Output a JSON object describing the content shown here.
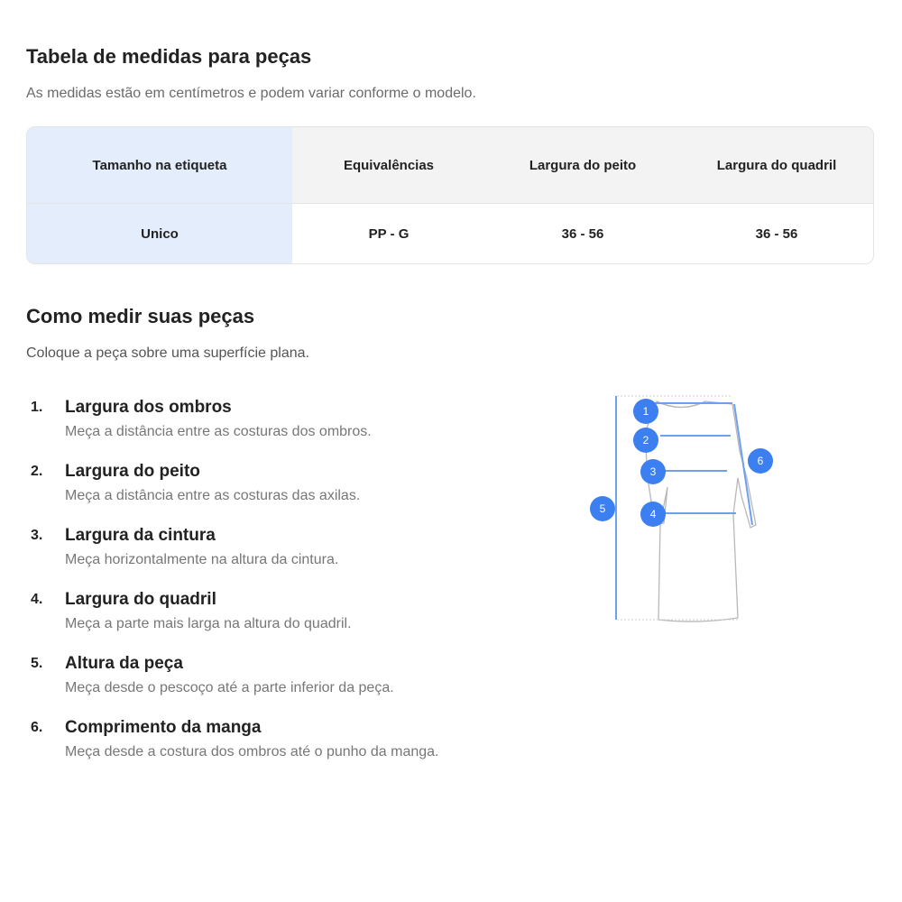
{
  "header": {
    "title": "Tabela de medidas para peças",
    "subtitle": "As medidas estão em centímetros e podem variar conforme o modelo."
  },
  "size_table": {
    "columns": [
      "Tamanho na etiqueta",
      "Equivalências",
      "Largura do peito",
      "Largura do quadril"
    ],
    "rows": [
      [
        "Unico",
        "PP - G",
        "36 - 56",
        "36 - 56"
      ]
    ]
  },
  "how_to": {
    "title": "Como medir suas peças",
    "subtitle": "Coloque a peça sobre uma superfície plana.",
    "steps": [
      {
        "num": "1.",
        "title": "Largura dos ombros",
        "desc": "Meça a distância entre as costuras dos ombros."
      },
      {
        "num": "2.",
        "title": "Largura do peito",
        "desc": "Meça a distância entre as costuras das axilas."
      },
      {
        "num": "3.",
        "title": "Largura da cintura",
        "desc": "Meça horizontalmente na altura da cintura."
      },
      {
        "num": "4.",
        "title": "Largura do quadril",
        "desc": "Meça a parte mais larga na altura do quadril."
      },
      {
        "num": "5.",
        "title": "Altura da peça",
        "desc": "Meça desde o pescoço até a parte inferior da peça."
      },
      {
        "num": "6.",
        "title": "Comprimento da manga",
        "desc": "Meça desde a costura dos ombros até o punho da manga."
      }
    ]
  },
  "diagram": {
    "markers": [
      "1",
      "2",
      "3",
      "4",
      "5",
      "6"
    ],
    "marker_color": "#3b7ff0",
    "line_color": "#6fa0ee",
    "garment_icon": "dress-outline-icon"
  }
}
